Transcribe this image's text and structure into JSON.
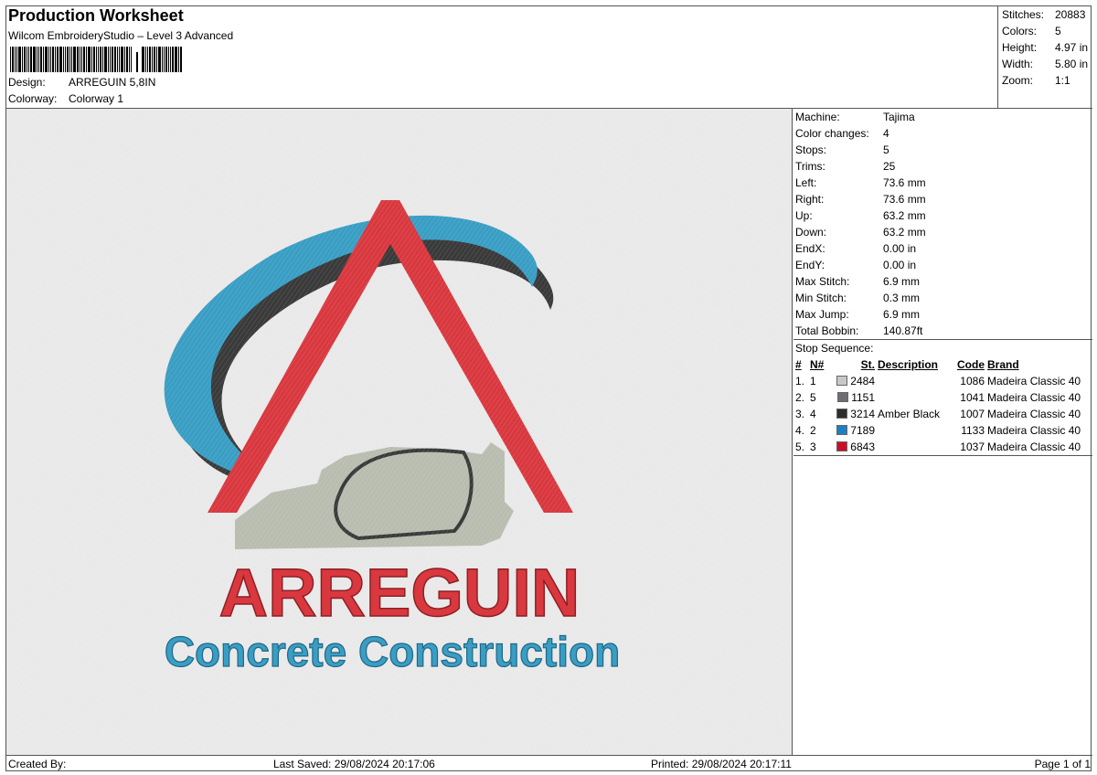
{
  "header": {
    "title": "Production Worksheet",
    "subtitle": "Wilcom EmbroideryStudio – Level 3 Advanced",
    "design_label": "Design:",
    "design_value": "ARREGUIN 5,8IN",
    "colorway_label": "Colorway:",
    "colorway_value": "Colorway 1"
  },
  "summary": {
    "stitches_label": "Stitches:",
    "stitches_value": "20883",
    "colors_label": "Colors:",
    "colors_value": "5",
    "height_label": "Height:",
    "height_value": "4.97 in",
    "width_label": "Width:",
    "width_value": "5.80 in",
    "zoom_label": "Zoom:",
    "zoom_value": "1:1"
  },
  "design": {
    "brand_text": "ARREGUIN",
    "tagline_text": "Concrete Construction",
    "colors": {
      "red": "#d9383f",
      "blue": "#3a9ec4",
      "dark": "#3a3a3a",
      "gray": "#b9bdb0",
      "background": "#e9e9e9"
    }
  },
  "machine": {
    "machine_label": "Machine:",
    "machine_value": "Tajima",
    "color_changes_label": "Color changes:",
    "color_changes_value": "4",
    "stops_label": "Stops:",
    "stops_value": "5",
    "trims_label": "Trims:",
    "trims_value": "25",
    "left_label": "Left:",
    "left_value": "73.6 mm",
    "right_label": "Right:",
    "right_value": "73.6 mm",
    "up_label": "Up:",
    "up_value": "63.2 mm",
    "down_label": "Down:",
    "down_value": "63.2 mm",
    "endx_label": "EndX:",
    "endx_value": "0.00 in",
    "endy_label": "EndY:",
    "endy_value": "0.00 in",
    "max_stitch_label": "Max Stitch:",
    "max_stitch_value": "6.9 mm",
    "min_stitch_label": "Min Stitch:",
    "min_stitch_value": "0.3 mm",
    "max_jump_label": "Max Jump:",
    "max_jump_value": "6.9 mm",
    "total_bobbin_label": "Total Bobbin:",
    "total_bobbin_value": "140.87ft"
  },
  "stop_sequence": {
    "title": "Stop Sequence:",
    "headers": {
      "num": "#",
      "n": "N#",
      "st": "St.",
      "description": "Description",
      "code": "Code",
      "brand": "Brand"
    },
    "rows": [
      {
        "num": "1.",
        "n": "1",
        "color": "#c8c8c8",
        "st": "2484",
        "description": "",
        "code": "1086",
        "brand": "Madeira Classic 40"
      },
      {
        "num": "2.",
        "n": "5",
        "color": "#6e6e73",
        "st": "1151",
        "description": "",
        "code": "1041",
        "brand": "Madeira Classic 40"
      },
      {
        "num": "3.",
        "n": "4",
        "color": "#2d2d2d",
        "st": "3214",
        "description": "Amber Black",
        "code": "1007",
        "brand": "Madeira Classic 40"
      },
      {
        "num": "4.",
        "n": "2",
        "color": "#1f7fc4",
        "st": "7189",
        "description": "",
        "code": "1133",
        "brand": "Madeira Classic 40"
      },
      {
        "num": "5.",
        "n": "3",
        "color": "#c8102e",
        "st": "6843",
        "description": "",
        "code": "1037",
        "brand": "Madeira Classic 40"
      }
    ]
  },
  "footer": {
    "created_by": "Created By:",
    "last_saved": "Last Saved: 29/08/2024 20:17:06",
    "printed": "Printed: 29/08/2024 20:17:11",
    "page": "Page 1 of 1"
  }
}
